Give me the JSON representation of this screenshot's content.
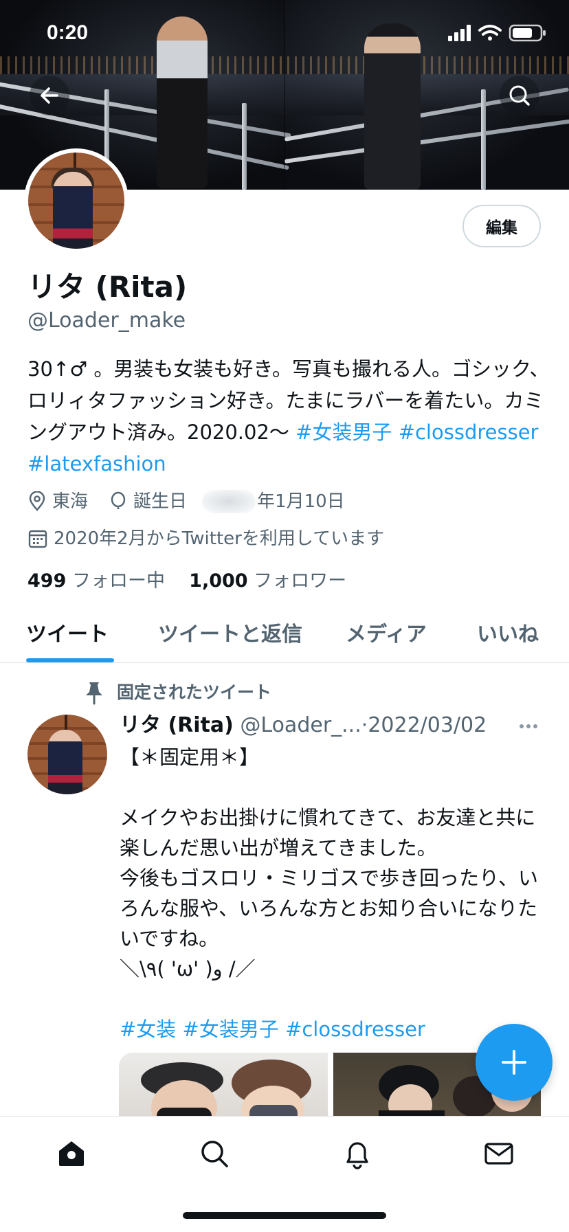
{
  "status_bar": {
    "time": "0:20"
  },
  "profile": {
    "display_name": "リタ (Rita)",
    "handle": "@Loader_make",
    "edit_label": "編集",
    "bio_text": "30↑♂ 。男装も女装も好き。写真も撮れる人。ゴシック、ロリィタファッション好き。たまにラバーを着たい。カミングアウト済み。2020.02〜 ",
    "bio_tags": [
      "#女装男子",
      "#clossdresser",
      "#latexfashion"
    ],
    "location": "東海",
    "birthday_label": "誕生日",
    "birthday_suffix": "年1月10日",
    "joined": "2020年2月からTwitterを利用しています",
    "following_count": "499",
    "following_label": "フォロー中",
    "followers_count": "1,000",
    "followers_label": "フォロワー"
  },
  "tabs": [
    "ツイート",
    "ツイートと返信",
    "メディア",
    "いいね"
  ],
  "tweet": {
    "pinned_label": "固定されたツイート",
    "author_name": "リタ (Rita)",
    "author_handle": "@Loader_...",
    "date": "2022/03/02",
    "body": "【＊固定用＊】\n\nメイクやお出掛けに慣れてきて、お友達と共に楽しんだ思い出が増えてきました。\n今後もゴスロリ・ミリゴスで歩き回ったり、いろんな服や、いろんな方とお知り合いになりたいですね。\n＼\\٩( 'ω' )و /／",
    "tags": [
      "#女装",
      "#女装男子",
      "#clossdresser"
    ]
  },
  "icons": {
    "back": "arrow-left-icon",
    "search": "search-icon",
    "location": "location-pin-icon",
    "birthday": "balloon-icon",
    "calendar": "calendar-icon",
    "pin": "pin-icon",
    "compose": "plus-icon",
    "nav": [
      "home-icon",
      "search-icon",
      "bell-icon",
      "mail-icon"
    ]
  },
  "colors": {
    "accent": "#1d9bf0",
    "text": "#0f1419",
    "muted": "#536471"
  }
}
